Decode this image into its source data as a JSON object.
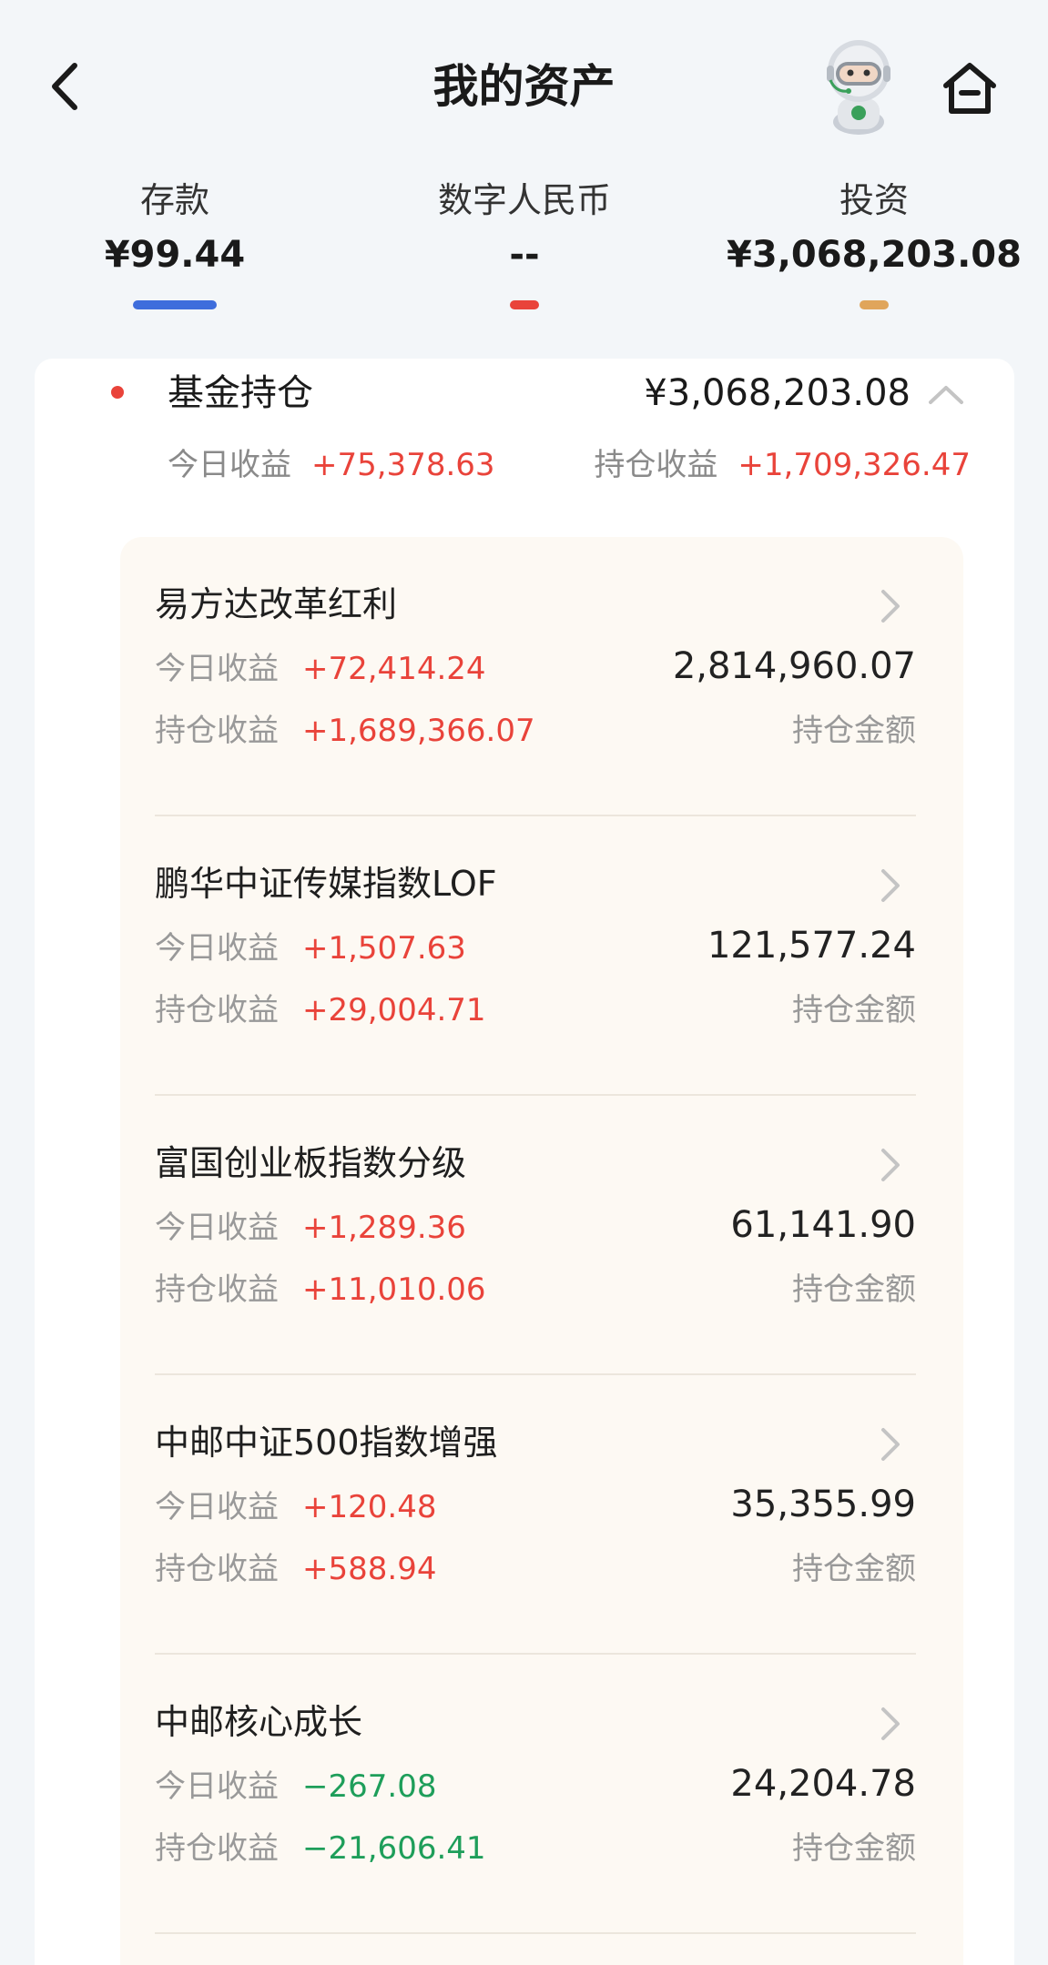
{
  "header": {
    "title": "我的资产",
    "back_icon": "chevron-left-icon",
    "assistant_icon": "robot-assistant-icon",
    "home_icon": "home-icon"
  },
  "asset_tabs": [
    {
      "label": "存款",
      "value": "¥99.44",
      "color": "#3e6ddc"
    },
    {
      "label": "数字人民币",
      "value": "--",
      "color": "#e9433a"
    },
    {
      "label": "投资",
      "value": "¥3,068,203.08",
      "color": "#e0a55b"
    }
  ],
  "fund_summary": {
    "title": "基金持仓",
    "total": "¥3,068,203.08",
    "today_label": "今日收益",
    "today_value": "+75,378.63",
    "hold_label": "持仓收益",
    "hold_value": "+1,709,326.47"
  },
  "funds": [
    {
      "name": "易方达改革红利",
      "today_label": "今日收益",
      "today": "+72,414.24",
      "hold_label": "持仓收益",
      "hold": "+1,689,366.07",
      "amount": "2,814,960.07",
      "amount_label": "持仓金额"
    },
    {
      "name": "鹏华中证传媒指数LOF",
      "today_label": "今日收益",
      "today": "+1,507.63",
      "hold_label": "持仓收益",
      "hold": "+29,004.71",
      "amount": "121,577.24",
      "amount_label": "持仓金额"
    },
    {
      "name": "富国创业板指数分级",
      "today_label": "今日收益",
      "today": "+1,289.36",
      "hold_label": "持仓收益",
      "hold": "+11,010.06",
      "amount": "61,141.90",
      "amount_label": "持仓金额"
    },
    {
      "name": "中邮中证500指数增强",
      "today_label": "今日收益",
      "today": "+120.48",
      "hold_label": "持仓收益",
      "hold": "+588.94",
      "amount": "35,355.99",
      "amount_label": "持仓金额"
    },
    {
      "name": "中邮核心成长",
      "today_label": "今日收益",
      "today": "−267.08",
      "hold_label": "持仓收益",
      "hold": "−21,606.41",
      "amount": "24,204.78",
      "amount_label": "持仓金额"
    }
  ],
  "colors": {
    "gain": "#e9433a",
    "loss": "#1e9e5a"
  }
}
